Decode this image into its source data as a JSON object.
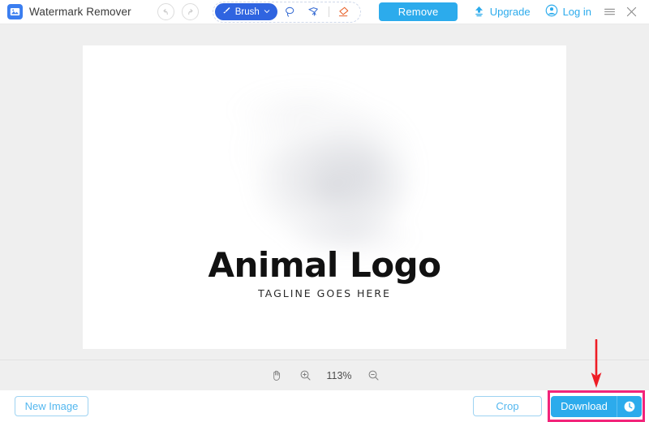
{
  "app": {
    "title": "Watermark Remover",
    "logo_icon": "image-photo-icon"
  },
  "toolbar": {
    "undo_icon": "undo-arrow-icon",
    "redo_icon": "redo-arrow-icon",
    "brush_label": "Brush",
    "brush_icon": "brush-icon",
    "brush_caret": "chevron-down-icon",
    "lasso_icon": "lasso-icon",
    "polygon_lasso_icon": "polygon-lasso-icon",
    "eraser_icon": "eraser-icon",
    "remove_label": "Remove"
  },
  "account": {
    "upgrade_label": "Upgrade",
    "upgrade_icon": "upload-arrow-icon",
    "login_label": "Log in",
    "login_icon": "user-circle-icon",
    "menu_icon": "hamburger-menu-icon",
    "close_icon": "close-x-icon"
  },
  "canvas": {
    "logo_title": "Animal Logo",
    "logo_tagline": "TAGLINE GOES HERE"
  },
  "zoom": {
    "hand_icon": "hand-pan-icon",
    "zoom_in_icon": "zoom-in-icon",
    "level": "113%",
    "zoom_out_icon": "zoom-out-icon"
  },
  "actions": {
    "new_image_label": "New Image",
    "crop_label": "Crop",
    "download_label": "Download",
    "download_icon": "clock-icon"
  },
  "annotation": {
    "arrow_color": "#ee1c25",
    "highlight_color": "#f2247a"
  },
  "colors": {
    "accent_blue": "#2cabec",
    "brush_blue": "#2f64e0",
    "logo_blue": "#3b7ef0",
    "stage_gray": "#efefef",
    "eraser_orange": "#e8622a"
  }
}
